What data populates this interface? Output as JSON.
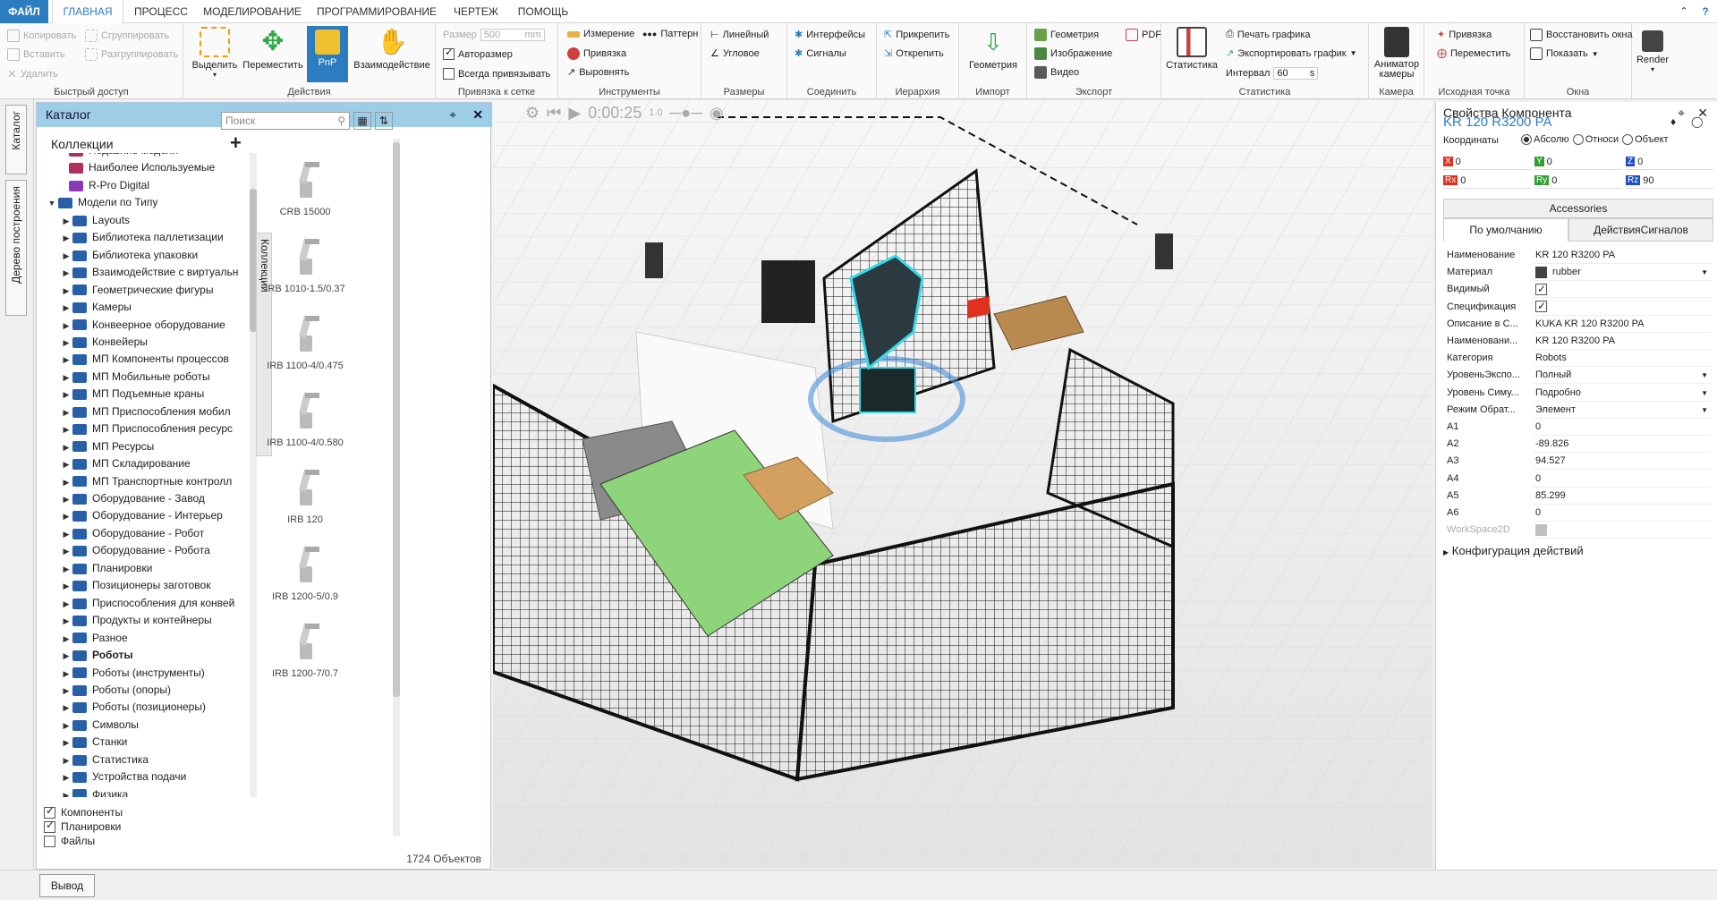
{
  "tabs": [
    "ФАЙЛ",
    "ГЛАВНАЯ",
    "ПРОЦЕСС",
    "МОДЕЛИРОВАНИЕ",
    "ПРОГРАММИРОВАНИЕ",
    "ЧЕРТЕЖ",
    "ПОМОЩЬ"
  ],
  "ribbon": {
    "quick": {
      "label": "Быстрый доступ",
      "copy": "Копировать",
      "paste": "Вставить",
      "delete": "Удалить",
      "group": "Сгруппировать",
      "ungroup": "Разгруппировать"
    },
    "actions": {
      "label": "Действия",
      "select": "Выделить",
      "move": "Переместить",
      "pnp": "PnP",
      "interact": "Взаимодействие"
    },
    "grid": {
      "label": "Привязка к сетке",
      "size_label": "Размер",
      "size_value": "500",
      "size_unit": "mm",
      "autosize": "Авторазмер",
      "always_snap": "Всегда привязывать"
    },
    "tools": {
      "label": "Инструменты",
      "measure": "Измерение",
      "pattern": "Паттерн",
      "snap": "Привязка",
      "align": "Выровнять"
    },
    "dims": {
      "label": "Размеры",
      "linear": "Линейный",
      "angular": "Угловое"
    },
    "connect": {
      "label": "Соединить",
      "interfaces": "Интерфейсы",
      "signals": "Сигналы"
    },
    "hierarchy": {
      "label": "Иерархия",
      "attach": "Прикрепить",
      "detach": "Открепить"
    },
    "import": {
      "label": "Импорт",
      "geometry": "Геометрия"
    },
    "export": {
      "label": "Экспорт",
      "geometry": "Геометрия",
      "image": "Изображение",
      "video": "Видео",
      "pdf": "PDF"
    },
    "stats": {
      "label": "Статистика",
      "stats": "Статистика",
      "print": "Печать графика",
      "export": "Экспортировать график",
      "interval": "Интервал",
      "interval_value": "60",
      "interval_unit": "s"
    },
    "camera": {
      "label": "Камера",
      "animator": "Аниматор камеры"
    },
    "origin": {
      "label": "Исходная точка",
      "snap": "Привязка",
      "move": "Переместить"
    },
    "window": {
      "label": "Окна",
      "restore": "Восстановить окна",
      "show": "Показать"
    },
    "render": "Render"
  },
  "vstrip": {
    "catalog": "Каталог",
    "tree": "Дерево построения"
  },
  "catalog": {
    "title": "Каталог",
    "collections": "Коллекции",
    "search_placeholder": "Поиск",
    "side_label": "Коллекции",
    "items": [
      {
        "label": "Недавние модели",
        "level": 1,
        "color": "#b03060"
      },
      {
        "label": "Наиболее Используемые",
        "level": 1,
        "color": "#b03060"
      },
      {
        "label": "R-Pro Digital",
        "level": 1,
        "color": "#8a3ab8"
      },
      {
        "label": "Модели по Типу",
        "level": 0,
        "color": "#2860a8"
      },
      {
        "label": "Layouts",
        "level": 2
      },
      {
        "label": "Библиотека паллетизации",
        "level": 2
      },
      {
        "label": "Библиотека упаковки",
        "level": 2
      },
      {
        "label": "Взаимодействие с виртуальн",
        "level": 2
      },
      {
        "label": "Геометрические фигуры",
        "level": 2
      },
      {
        "label": "Камеры",
        "level": 2
      },
      {
        "label": "Конвеерное оборудование",
        "level": 2
      },
      {
        "label": "Конвейеры",
        "level": 2
      },
      {
        "label": "МП Компоненты процессов",
        "level": 2
      },
      {
        "label": "МП Мобильные роботы",
        "level": 2
      },
      {
        "label": "МП Подъемные краны",
        "level": 2
      },
      {
        "label": "МП Приспособления мобил",
        "level": 2
      },
      {
        "label": "МП Приспособления ресурс",
        "level": 2
      },
      {
        "label": "МП Ресурсы",
        "level": 2
      },
      {
        "label": "МП Складирование",
        "level": 2
      },
      {
        "label": "МП Транспортные контролл",
        "level": 2
      },
      {
        "label": "Оборудование - Завод",
        "level": 2
      },
      {
        "label": "Оборудование - Интерьер",
        "level": 2
      },
      {
        "label": "Оборудование - Робот",
        "level": 2
      },
      {
        "label": "Оборудование - Робота",
        "level": 2
      },
      {
        "label": "Планировки",
        "level": 2
      },
      {
        "label": "Позиционеры заготовок",
        "level": 2
      },
      {
        "label": "Приспособления для конвей",
        "level": 2
      },
      {
        "label": "Продукты и контейнеры",
        "level": 2
      },
      {
        "label": "Разное",
        "level": 2
      },
      {
        "label": "Роботы",
        "level": 2,
        "bold": true
      },
      {
        "label": "Роботы (инструменты)",
        "level": 2
      },
      {
        "label": "Роботы (опоры)",
        "level": 2
      },
      {
        "label": "Роботы (позиционеры)",
        "level": 2
      },
      {
        "label": "Символы",
        "level": 2
      },
      {
        "label": "Станки",
        "level": 2
      },
      {
        "label": "Статистика",
        "level": 2
      },
      {
        "label": "Устройства подачи",
        "level": 2
      },
      {
        "label": "Физика",
        "level": 2
      }
    ],
    "filters": [
      {
        "label": "Компоненты",
        "checked": true
      },
      {
        "label": "Планировки",
        "checked": true
      },
      {
        "label": "Файлы",
        "checked": false
      }
    ],
    "models": [
      "CRB 15000",
      "IRB 1010-1.5/0.37",
      "IRB 1100-4/0.475",
      "IRB 1100-4/0.580",
      "IRB 120",
      "IRB 1200-5/0.9",
      "IRB 1200-7/0.7"
    ],
    "count": "1724 Объектов"
  },
  "viewport": {
    "time": "0:00:25",
    "speed": "1.0"
  },
  "props": {
    "title": "Свойства Компонента",
    "component": "KR 120 R3200 PA",
    "coords_label": "Координаты",
    "coord_modes": [
      "Абсолю",
      "Относи",
      "Объект"
    ],
    "coord_values": [
      {
        "axis": "X",
        "value": "0",
        "color": "#e03020"
      },
      {
        "axis": "Y",
        "value": "0",
        "color": "#30a030"
      },
      {
        "axis": "Z",
        "value": "0",
        "color": "#2050c0"
      },
      {
        "axis": "Rx",
        "value": "0",
        "color": "#e03020"
      },
      {
        "axis": "Ry",
        "value": "0",
        "color": "#30a030"
      },
      {
        "axis": "Rz",
        "value": "90",
        "color": "#2050c0"
      }
    ],
    "accessories": "Accessories",
    "tab_default": "По умолчанию",
    "tab_signals": "ДействияСигналов",
    "rows": [
      {
        "label": "Наименование",
        "value": "KR 120 R3200 PA"
      },
      {
        "label": "Материал",
        "value": "rubber",
        "dropdown": true,
        "swatch": true
      },
      {
        "label": "Видимый",
        "check": true
      },
      {
        "label": "Спецификация",
        "check": true
      },
      {
        "label": "Описание в С...",
        "value": "KUKA KR 120 R3200 PA"
      },
      {
        "label": "Наименовани...",
        "value": "KR 120 R3200 PA"
      },
      {
        "label": "Категория",
        "value": "Robots"
      },
      {
        "label": "УровеньЭкспо...",
        "value": "Полный",
        "dropdown": true
      },
      {
        "label": "Уровень Симу...",
        "value": "Подробно",
        "dropdown": true
      },
      {
        "label": "Режим Обрат...",
        "value": "Элемент",
        "dropdown": true
      },
      {
        "label": "A1",
        "value": "0"
      },
      {
        "label": "A2",
        "value": "-89.826"
      },
      {
        "label": "A3",
        "value": "94.527"
      },
      {
        "label": "A4",
        "value": "0"
      },
      {
        "label": "A5",
        "value": "85.299"
      },
      {
        "label": "A6",
        "value": "0"
      },
      {
        "label": "WorkSpace2D",
        "swatch_only": true,
        "disabled": true
      }
    ],
    "actions_config": "Конфигурация действий"
  },
  "bottom": {
    "output": "Вывод"
  }
}
